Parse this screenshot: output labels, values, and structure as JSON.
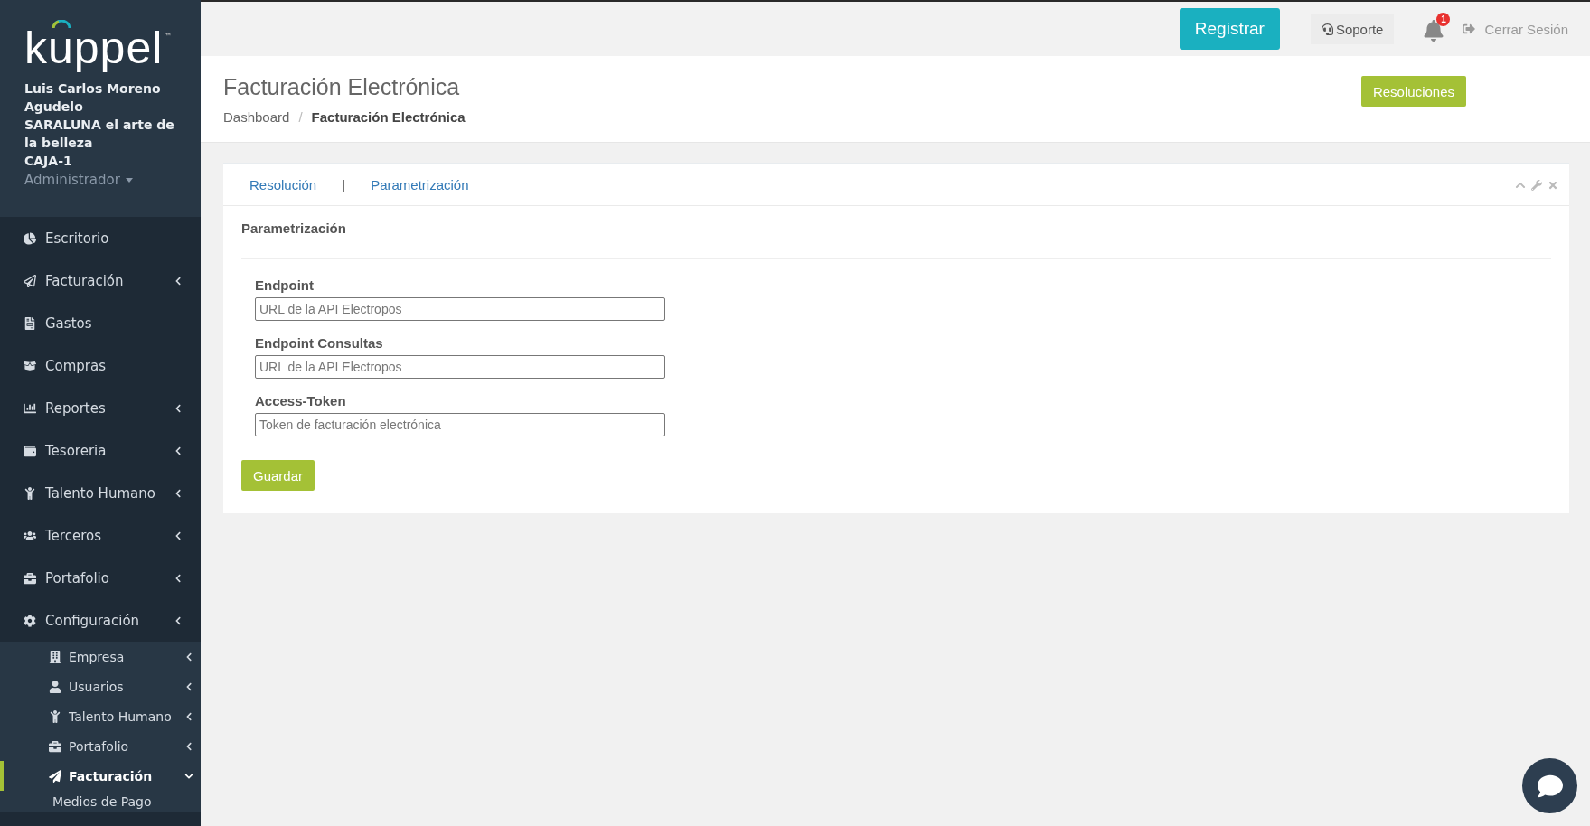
{
  "brand": {
    "logo": "kuppel",
    "trademark": "™"
  },
  "user": {
    "lines": [
      "Luis Carlos Moreno Agudelo",
      "SARALUNA el arte de la belleza",
      "CAJA-1"
    ],
    "role": "Administrador"
  },
  "sidebar": {
    "items": [
      {
        "label": "Escritorio",
        "kind": "link",
        "selected": false
      },
      {
        "label": "Facturación",
        "kind": "menu",
        "selected": false
      },
      {
        "label": "Gastos",
        "kind": "link",
        "selected": false
      },
      {
        "label": "Compras",
        "kind": "link",
        "selected": false
      },
      {
        "label": "Reportes",
        "kind": "menu",
        "selected": false
      },
      {
        "label": "Tesoreria",
        "kind": "menu",
        "selected": false
      },
      {
        "label": "Talento Humano",
        "kind": "menu",
        "selected": false
      },
      {
        "label": "Terceros",
        "kind": "menu",
        "selected": false
      },
      {
        "label": "Portafolio",
        "kind": "menu",
        "selected": false
      },
      {
        "label": "Configuración",
        "kind": "menu",
        "selected": false,
        "children": [
          {
            "label": "Empresa",
            "expanded": false,
            "selected": false
          },
          {
            "label": "Usuarios",
            "expanded": false,
            "selected": false
          },
          {
            "label": "Talento Humano",
            "expanded": false,
            "selected": false
          },
          {
            "label": "Portafolio",
            "expanded": false,
            "selected": false
          },
          {
            "label": "Facturación",
            "expanded": true,
            "selected": true,
            "children": [
              {
                "label": "Medios de Pago"
              }
            ]
          }
        ]
      }
    ]
  },
  "topbar": {
    "register": "Registrar",
    "support": "Soporte",
    "notifications": "1",
    "logout": "Cerrar Sesión"
  },
  "page": {
    "title": "Facturación Electrónica",
    "breadcrumb": [
      "Dashboard",
      "Facturación Electrónica"
    ],
    "breadcrumb_separator": "/",
    "action": "Resoluciones"
  },
  "panel": {
    "tabs": [
      {
        "label": "Resolución"
      },
      {
        "label": "Parametrización"
      }
    ],
    "separator": "|",
    "heading": "Parametrización",
    "fields": [
      {
        "label": "Endpoint",
        "placeholder": "URL de la API Electropos"
      },
      {
        "label": "Endpoint Consultas",
        "placeholder": "URL de la API Electropos"
      },
      {
        "label": "Access-Token",
        "placeholder": "Token de facturación electrónica"
      }
    ],
    "submit": "Guardar"
  }
}
